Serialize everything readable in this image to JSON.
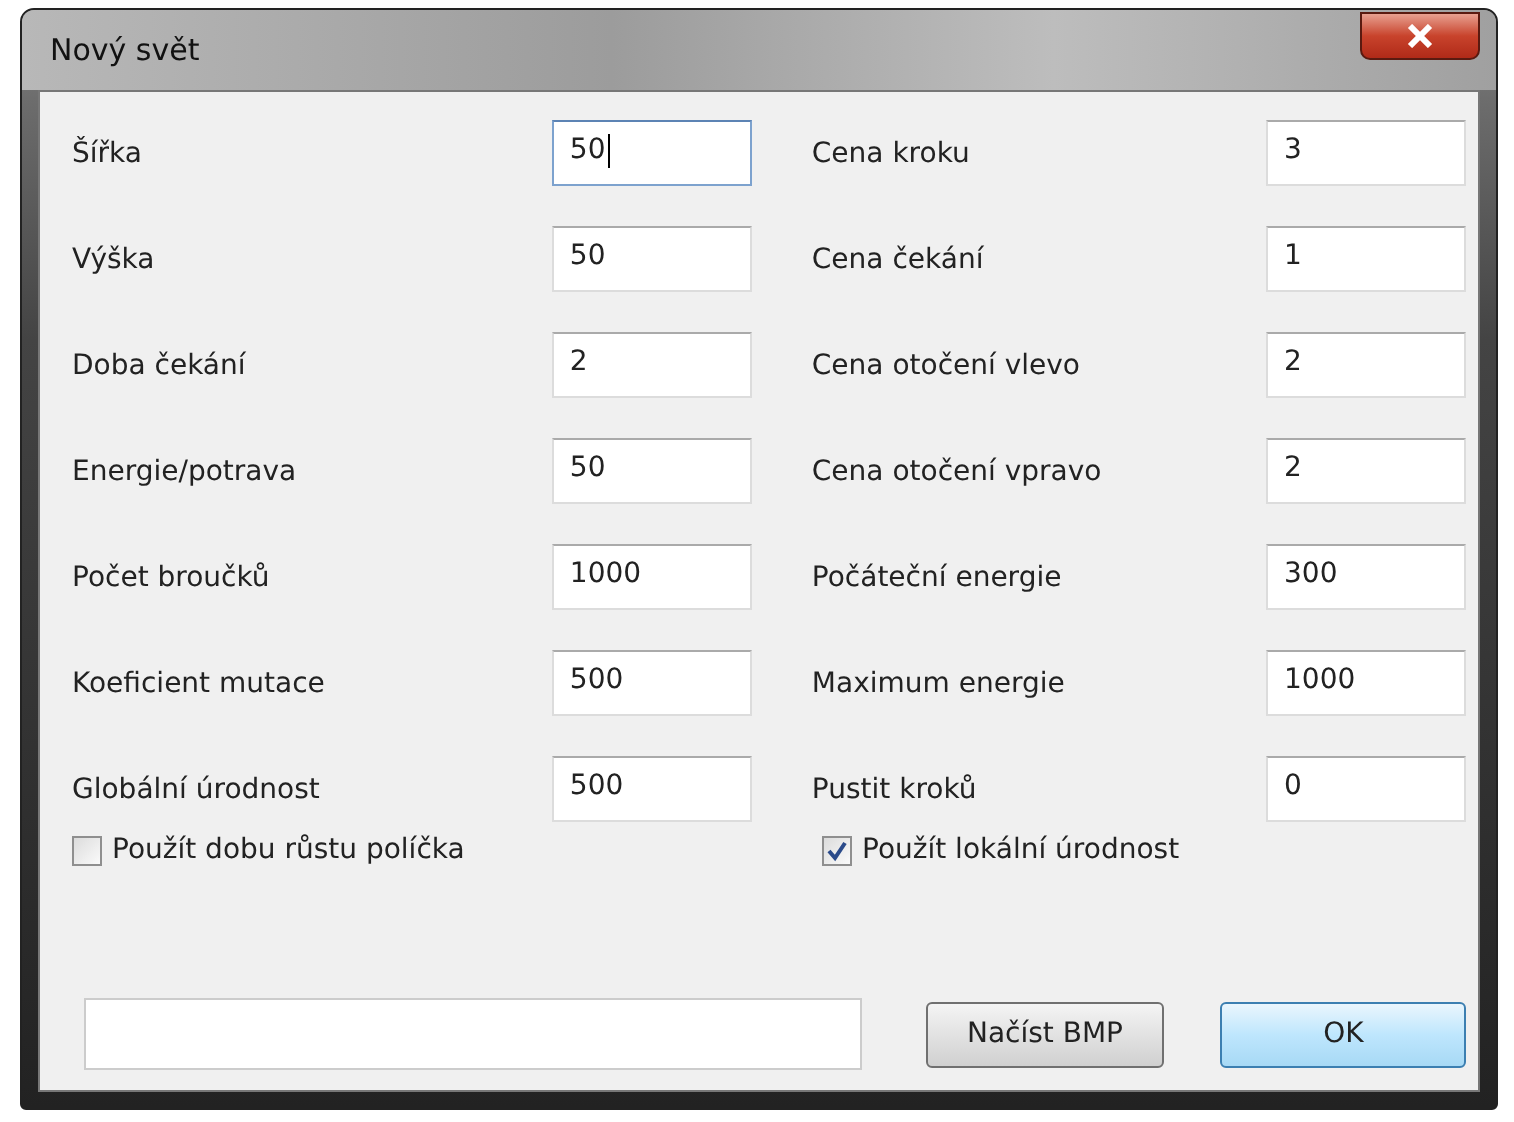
{
  "window": {
    "title": "Nový svět"
  },
  "left_fields": [
    {
      "label": "Šířka",
      "value": "50",
      "focused": true
    },
    {
      "label": "Výška",
      "value": "50",
      "focused": false
    },
    {
      "label": "Doba čekání",
      "value": "2",
      "focused": false
    },
    {
      "label": "Energie/potrava",
      "value": "50",
      "focused": false
    },
    {
      "label": "Počet broučků",
      "value": "1000",
      "focused": false
    },
    {
      "label": "Koeficient mutace",
      "value": "500",
      "focused": false
    },
    {
      "label": "Globální úrodnost",
      "value": "500",
      "focused": false
    }
  ],
  "right_fields": [
    {
      "label": "Cena kroku",
      "value": "3",
      "focused": false
    },
    {
      "label": "Cena čekání",
      "value": "1",
      "focused": false
    },
    {
      "label": "Cena otočení vlevo",
      "value": "2",
      "focused": false
    },
    {
      "label": "Cena otočení vpravo",
      "value": "2",
      "focused": false
    },
    {
      "label": "Počáteční energie",
      "value": "300",
      "focused": false
    },
    {
      "label": "Maximum energie",
      "value": "1000",
      "focused": false
    },
    {
      "label": "Pustit kroků",
      "value": "0",
      "focused": false
    }
  ],
  "checkboxes": [
    {
      "label": "Použít dobu růstu políčka",
      "checked": false
    },
    {
      "label": "Použít lokální úrodnost",
      "checked": true
    }
  ],
  "buttons": [
    {
      "label": "Načíst BMP",
      "kind": "normal"
    },
    {
      "label": "OK",
      "kind": "default"
    }
  ]
}
